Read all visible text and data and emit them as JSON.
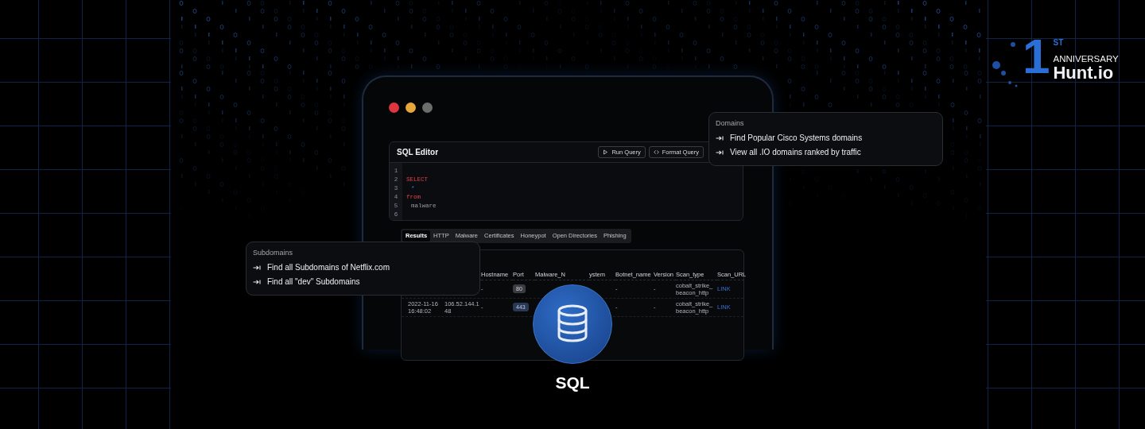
{
  "brand": {
    "ordinal": "1",
    "suffix": "ST",
    "label": "ANNIVERSARY",
    "name": "Hunt.io"
  },
  "window": {
    "controls": [
      {
        "color": "#e0353e"
      },
      {
        "color": "#e6a83b"
      },
      {
        "color": "#6a6d69"
      }
    ]
  },
  "editor": {
    "title": "SQL Editor",
    "buttons": [
      {
        "kind": "run",
        "label": "Run Query"
      },
      {
        "kind": "format",
        "label": "Format Query"
      }
    ],
    "lines": [
      {
        "number": "1"
      },
      {
        "number": "2",
        "code": "SELECT",
        "kind": "keyword",
        "indent": false
      },
      {
        "number": "3",
        "code": "*",
        "kind": "symbol",
        "indent": true
      },
      {
        "number": "4",
        "code": "from",
        "kind": "keyword",
        "indent": false
      },
      {
        "number": "5",
        "code": "malware",
        "kind": "identifier",
        "indent": true
      },
      {
        "number": "6"
      }
    ]
  },
  "result_tabs": [
    {
      "label": "Results",
      "selected": true
    },
    {
      "label": "HTTP",
      "selected": false
    },
    {
      "label": "Malware",
      "selected": false
    },
    {
      "label": "Certificates",
      "selected": false
    },
    {
      "label": "Honeypot",
      "selected": false
    },
    {
      "label": "Open Directories",
      "selected": false
    },
    {
      "label": "Phishing",
      "selected": false
    }
  ],
  "results": {
    "columns": [
      "Hostname",
      "Port",
      "Malware_N",
      "ystem",
      "Botnet_name",
      "Version",
      "Scan_type",
      "Scan_URL"
    ],
    "rows": [
      {
        "hostname": "-",
        "port": "80",
        "botnet_name": "-",
        "version": "-",
        "scan_type": "cobalt_strike_ beacon_http",
        "scan_url": "LINK"
      },
      {
        "timestamp": "2022-11-16 16:48:02",
        "ip": "106.52.144.148",
        "hostname": "-",
        "port": "443",
        "botnet_name": "-",
        "version": "-",
        "scan_type": "cobalt_strike_ beacon_http",
        "scan_url": "LINK"
      }
    ]
  },
  "popups": [
    {
      "kind": "domains",
      "title": "Domains",
      "items": [
        "Find Popular Cisco Systems domains",
        "View all .IO domains ranked by traffic"
      ]
    },
    {
      "kind": "subdomains",
      "title": "Subdomains",
      "items": [
        "Find all Subdomains of Netflix.com",
        "Find all \"dev\" Subdomains"
      ]
    }
  ],
  "hero": {
    "label": "SQL"
  }
}
